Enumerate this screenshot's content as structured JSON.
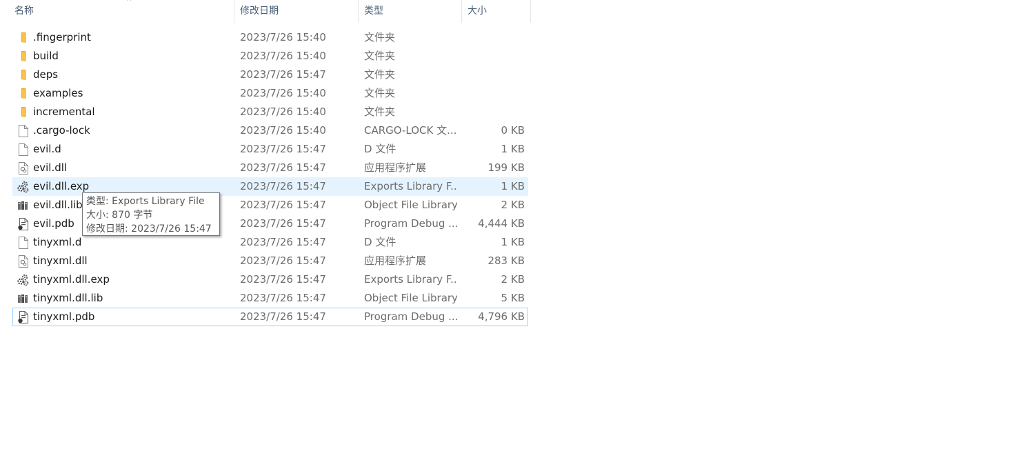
{
  "columns": {
    "name": "名称",
    "modified": "修改日期",
    "type": "类型",
    "size": "大小",
    "sort_indicator": "^"
  },
  "files": [
    {
      "name": ".fingerprint",
      "modified": "2023/7/26 15:40",
      "type": "文件夹",
      "size": "",
      "icon": "folder-icon"
    },
    {
      "name": "build",
      "modified": "2023/7/26 15:40",
      "type": "文件夹",
      "size": "",
      "icon": "folder-icon"
    },
    {
      "name": "deps",
      "modified": "2023/7/26 15:47",
      "type": "文件夹",
      "size": "",
      "icon": "folder-icon"
    },
    {
      "name": "examples",
      "modified": "2023/7/26 15:40",
      "type": "文件夹",
      "size": "",
      "icon": "folder-icon"
    },
    {
      "name": "incremental",
      "modified": "2023/7/26 15:40",
      "type": "文件夹",
      "size": "",
      "icon": "folder-icon"
    },
    {
      "name": ".cargo-lock",
      "modified": "2023/7/26 15:40",
      "type": "CARGO-LOCK 文...",
      "size": "0 KB",
      "icon": "blank-file-icon"
    },
    {
      "name": "evil.d",
      "modified": "2023/7/26 15:47",
      "type": "D 文件",
      "size": "1 KB",
      "icon": "blank-file-icon"
    },
    {
      "name": "evil.dll",
      "modified": "2023/7/26 15:47",
      "type": "应用程序扩展",
      "size": "199 KB",
      "icon": "dll-file-icon"
    },
    {
      "name": "evil.dll.exp",
      "modified": "2023/7/26 15:47",
      "type": "Exports Library F...",
      "size": "1 KB",
      "icon": "exp-file-icon"
    },
    {
      "name": "evil.dll.lib",
      "modified": "2023/7/26 15:47",
      "type": "Object File Library",
      "size": "2 KB",
      "icon": "lib-file-icon"
    },
    {
      "name": "evil.pdb",
      "modified": "2023/7/26 15:47",
      "type": "Program Debug ...",
      "size": "4,444 KB",
      "icon": "pdb-file-icon"
    },
    {
      "name": "tinyxml.d",
      "modified": "2023/7/26 15:47",
      "type": "D 文件",
      "size": "1 KB",
      "icon": "blank-file-icon"
    },
    {
      "name": "tinyxml.dll",
      "modified": "2023/7/26 15:47",
      "type": "应用程序扩展",
      "size": "283 KB",
      "icon": "dll-file-icon"
    },
    {
      "name": "tinyxml.dll.exp",
      "modified": "2023/7/26 15:47",
      "type": "Exports Library F...",
      "size": "2 KB",
      "icon": "exp-file-icon"
    },
    {
      "name": "tinyxml.dll.lib",
      "modified": "2023/7/26 15:47",
      "type": "Object File Library",
      "size": "5 KB",
      "icon": "lib-file-icon"
    },
    {
      "name": "tinyxml.pdb",
      "modified": "2023/7/26 15:47",
      "type": "Program Debug ...",
      "size": "4,796 KB",
      "icon": "pdb-file-icon"
    }
  ],
  "hovered_row": 8,
  "focused_row": 15,
  "tooltip": {
    "line1": "类型: Exports Library File",
    "line2": "大小: 870 字节",
    "line3": "修改日期: 2023/7/26 15:47"
  },
  "colors": {
    "hover_bg": "#e5f3ff",
    "focus_border": "#99d1ff",
    "header_text": "#4c607a",
    "folder": "#f8c24e"
  }
}
